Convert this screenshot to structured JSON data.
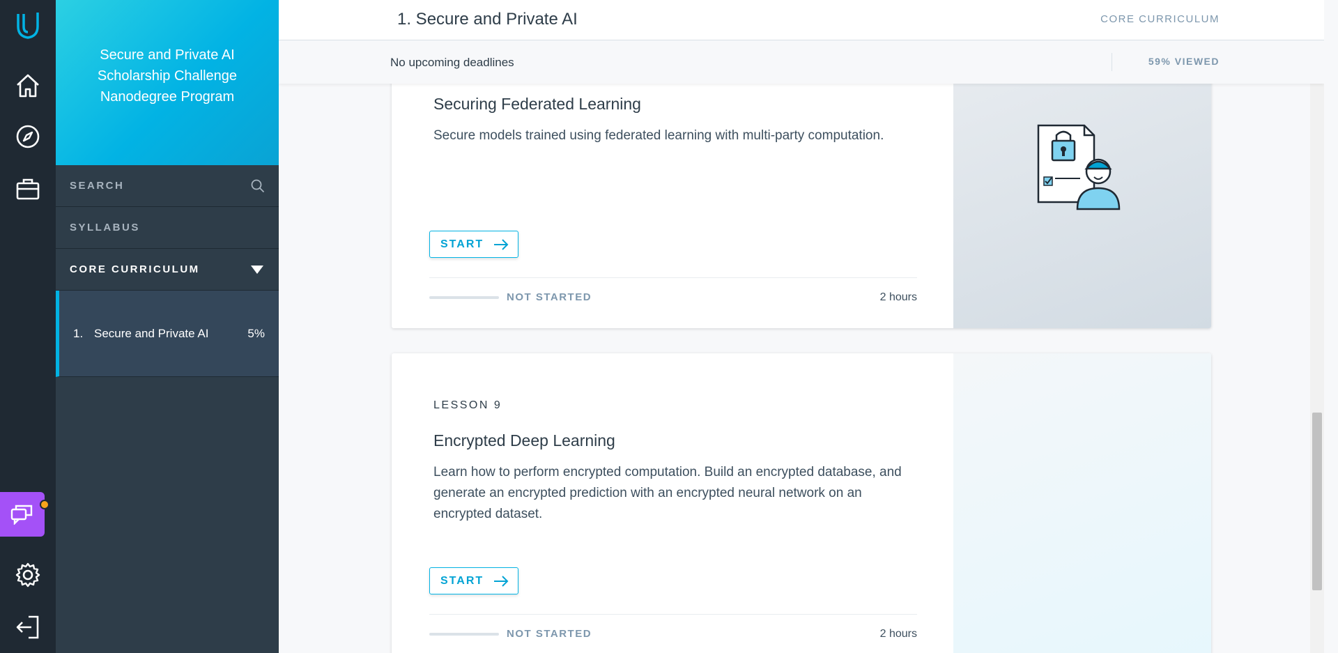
{
  "rail": {
    "items": [
      "udacity-logo",
      "home",
      "explore",
      "career",
      "chat",
      "settings",
      "logout"
    ]
  },
  "sidebar": {
    "program_title": "Secure and Private AI Scholarship Challenge Nanodegree Program",
    "search_label": "SEARCH",
    "syllabus_label": "SYLLABUS",
    "section_label": "CORE CURRICULUM",
    "lessons": [
      {
        "num": "1.",
        "name": "Secure and Private AI",
        "percent": "5%"
      }
    ]
  },
  "header": {
    "title": "1. Secure and Private AI",
    "section": "CORE CURRICULUM",
    "deadlines": "No upcoming deadlines",
    "viewed": "59% VIEWED"
  },
  "lessons": [
    {
      "title": "Securing Federated Learning",
      "description": "Secure models trained using federated learning with multi-party computation.",
      "button": "START",
      "status": "NOT STARTED",
      "duration": "2 hours",
      "progress": 0
    },
    {
      "kicker": "LESSON 9",
      "title": "Encrypted Deep Learning",
      "description": "Learn how to perform encrypted computation. Build an encrypted database, and generate an encrypted prediction with an encrypted neural network on an encrypted dataset.",
      "button": "START",
      "status": "NOT STARTED",
      "duration": "2 hours",
      "progress": 0
    }
  ],
  "colors": {
    "accent": "#02b3e4",
    "rail_bg": "#1f2933",
    "sidebar_bg": "#2e3d49",
    "chat": "#a451f7",
    "notification": "#f7a31b"
  }
}
